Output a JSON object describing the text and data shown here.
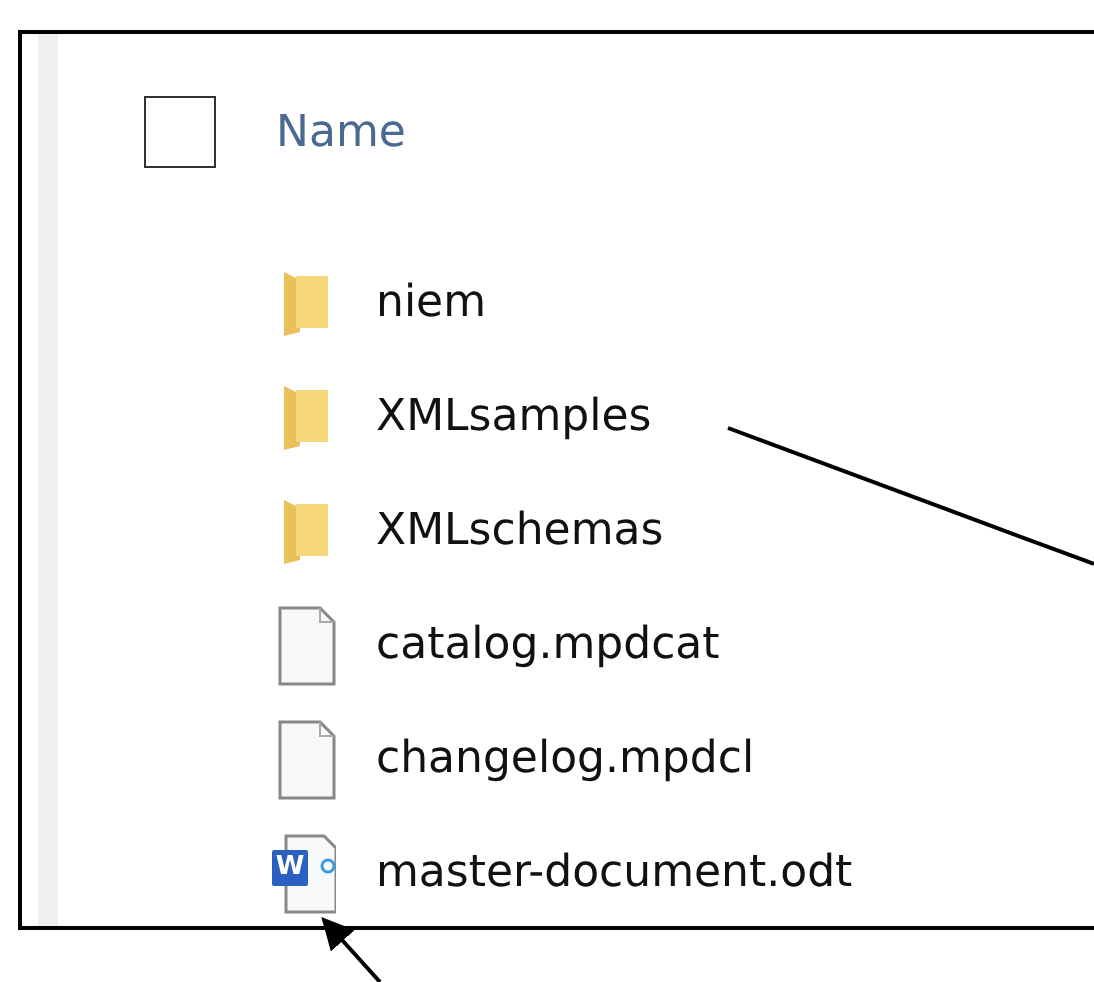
{
  "header": {
    "checked": false,
    "label": "Name"
  },
  "files": [
    {
      "kind": "folder",
      "name": "niem"
    },
    {
      "kind": "folder",
      "name": "XMLsamples"
    },
    {
      "kind": "folder",
      "name": "XMLschemas"
    },
    {
      "kind": "file",
      "name": "catalog.mpdcat"
    },
    {
      "kind": "file",
      "name": "changelog.mpdcl"
    },
    {
      "kind": "document",
      "name": "master-document.odt",
      "badge": "W"
    }
  ]
}
